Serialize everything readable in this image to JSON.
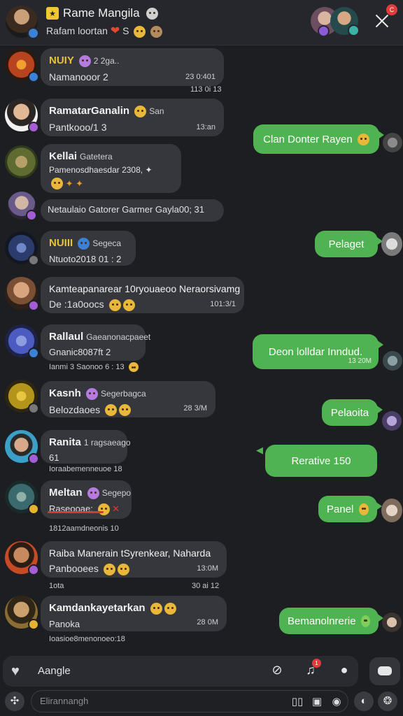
{
  "header": {
    "title": "Rame Mangila",
    "subtitle": "Rafam loortan",
    "subtitle_suffix": "S",
    "notification_count": "C"
  },
  "messages_in": [
    {
      "name": "NUIY",
      "badge": "2 2ga..",
      "text": "Namanooor  2",
      "time": "23 0:401",
      "meta": "113 0i 13",
      "avatar_color": "#b8431f"
    },
    {
      "name": "RamatarGanalin",
      "badge": "San",
      "text": "Pantkooo/1  3",
      "time": "13:an",
      "meta": "",
      "avatar_color": "#caa27c"
    },
    {
      "name": "Kellai",
      "badge": "Gatetera",
      "text": "Pamenosdhaesdar 2308,",
      "time": "",
      "meta": "",
      "avatar_color": "#5f6b31"
    },
    {
      "name": "Netaulaio Gatorer Garmer Gayla00; 31",
      "badge": "",
      "text": "",
      "time": "",
      "meta": "",
      "avatar_color": "#8d7ab8"
    },
    {
      "name": "NUIII",
      "badge": "Segeca",
      "text": "Ntuoto2018 01 : 2",
      "time": "",
      "meta": "",
      "avatar_color": "#2b3c6c"
    },
    {
      "name": "Kamteapanarear 10ryouaeoo Neraorsivamg",
      "badge": "",
      "text": "De :1a0oocs",
      "time": "101:3/1",
      "meta": "",
      "avatar_color": "#a7764e"
    },
    {
      "name": "Rallaul",
      "badge": "Gaeanonacpaeet",
      "text": "Gnanic8087ft 2",
      "time": "",
      "meta": "Ianmi 3 Saonoo 6 : 13",
      "avatar_color": "#4b5bc0"
    },
    {
      "name": "Kasnh",
      "badge": "Segerbagca",
      "text": "Belozdaoes",
      "time": "28 3/M",
      "meta": "",
      "avatar_color": "#b3951c"
    },
    {
      "name": "Ranita",
      "badge": "1 ragsaeago",
      "text": "61",
      "time": "",
      "meta": "Ioraabemenneuoe 18",
      "avatar_color": "#3aa0c8"
    },
    {
      "name": "Meltan",
      "badge": "Segepo",
      "text": "Raseooae:",
      "time": "",
      "meta": "1812aamdneonis 10",
      "avatar_color": "#3b6a6e"
    },
    {
      "name": "Raiba Manerain tSyrenkear, Naharda",
      "badge": "",
      "text": "Panbooees",
      "time": "13:0M",
      "meta": "1ota",
      "meta_right": "30 ai 12",
      "avatar_color": "#c84a24"
    },
    {
      "name": "Kamdankayetarkan",
      "badge": "",
      "text": "Panoka",
      "time": "28 0M",
      "meta": "Ioasioe8menonoeo:18",
      "avatar_color": "#8b6d34"
    }
  ],
  "messages_out": [
    {
      "text": "Clan Donter Rayen",
      "time": ""
    },
    {
      "text": "Pelaget",
      "time": ""
    },
    {
      "text": "Deon lolldar Inndud.",
      "time": "13 20M"
    },
    {
      "text": "Pelaoita",
      "time": ""
    },
    {
      "text": "Rerative 150",
      "time": ""
    },
    {
      "text": "Panel",
      "time": ""
    },
    {
      "text": "Bemanolnrerie",
      "time": ""
    }
  ],
  "reply_bar": {
    "label": "Aangle",
    "badge": "1"
  },
  "composer": {
    "placeholder": "Elirannangh"
  },
  "colors": {
    "accent_green": "#4eb350",
    "bubble_in": "#36373c",
    "background": "#1d1e22",
    "gold": "#e6c234",
    "notify_red": "#e23b3b"
  },
  "icons": [
    "heart-icon",
    "compass-icon",
    "bell-icon",
    "chat-icon",
    "keyboard-icon",
    "gamepad-icon",
    "book-icon",
    "image-icon",
    "timer-icon",
    "mic-icon",
    "sticker-icon",
    "close-icon"
  ]
}
